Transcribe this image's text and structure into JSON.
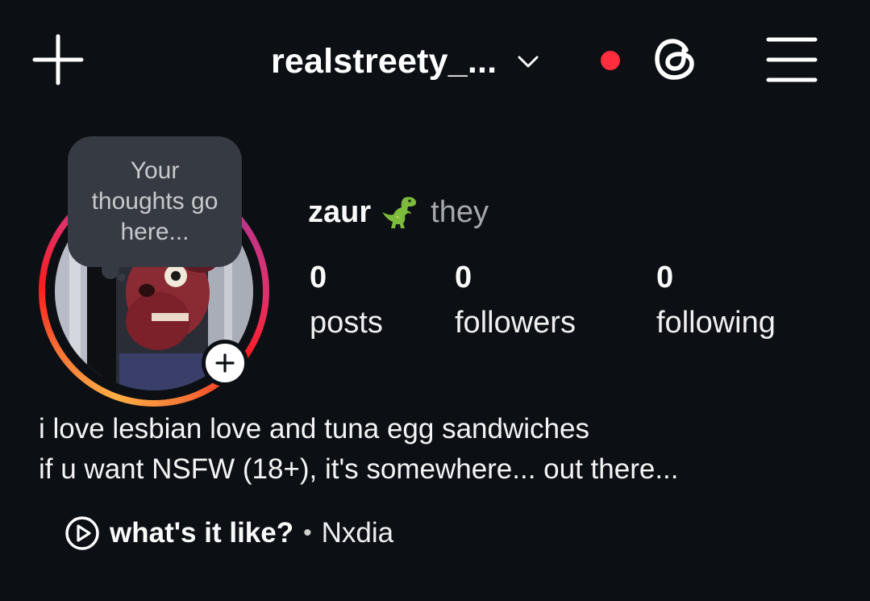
{
  "header": {
    "username": "realstreety_...",
    "notification_dot_color": "#ff2d3d",
    "icons": [
      "plus-icon",
      "chevron-down-icon",
      "threads-icon",
      "hamburger-menu-icon"
    ]
  },
  "note": {
    "text": "Your thoughts go here..."
  },
  "profile": {
    "display_name": "zaur",
    "name_emoji": "t-rex-emoji",
    "pronouns": "they",
    "stats": [
      {
        "value": "0",
        "label": "posts"
      },
      {
        "value": "0",
        "label": "followers"
      },
      {
        "value": "0",
        "label": "following"
      }
    ]
  },
  "bio": {
    "line1": "i love lesbian love and tuna egg sandwiches",
    "line2": "if u want NSFW (18+), it's somewhere... out there..."
  },
  "music": {
    "song": "what's it like?",
    "separator": "•",
    "artist": "Nxdia"
  },
  "colors": {
    "background": "#0c0f14",
    "note_bubble": "#363a42",
    "story_ring": [
      "#fcaf45",
      "#f77737",
      "#fd1d1d",
      "#e1306c",
      "#c13584",
      "#833ab4"
    ]
  }
}
